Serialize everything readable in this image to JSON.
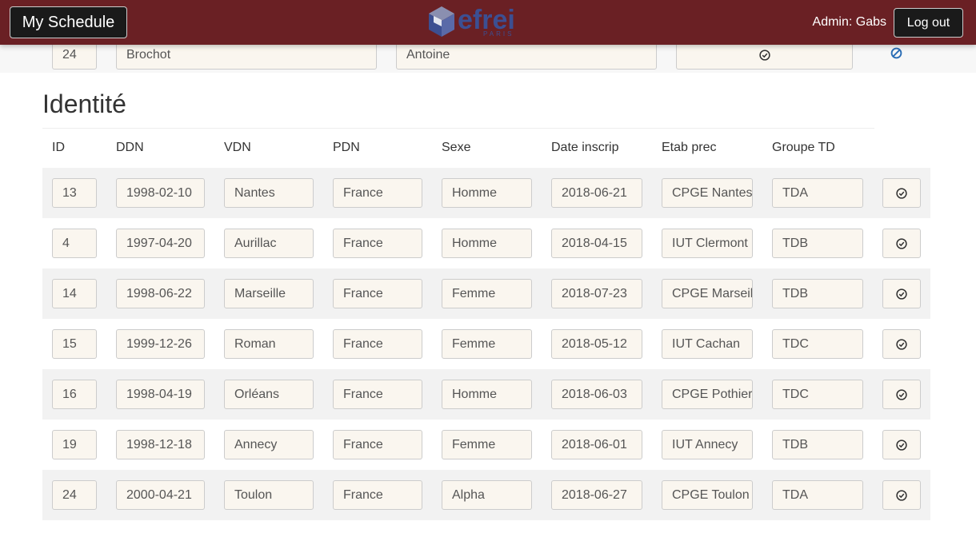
{
  "navbar": {
    "brand_label": "My Schedule",
    "logo_text": "efrei",
    "logo_sub": "PARIS",
    "admin_label": "Admin: Gabs",
    "logout_label": "Log out"
  },
  "top_row": {
    "id": "24",
    "last_name": "Brochot",
    "first_name": "Antoine"
  },
  "section": {
    "title": "Identité",
    "headers": [
      "ID",
      "DDN",
      "VDN",
      "PDN",
      "Sexe",
      "Date inscrip",
      "Etab prec",
      "Groupe TD"
    ]
  },
  "rows": [
    {
      "id": "13",
      "ddn": "1998-02-10",
      "vdn": "Nantes",
      "pdn": "France",
      "sexe": "Homme",
      "date": "2018-06-21",
      "etab": "CPGE Nantes",
      "groupe": "TDA"
    },
    {
      "id": "4",
      "ddn": "1997-04-20",
      "vdn": "Aurillac",
      "pdn": "France",
      "sexe": "Homme",
      "date": "2018-04-15",
      "etab": "IUT Clermont",
      "groupe": "TDB"
    },
    {
      "id": "14",
      "ddn": "1998-06-22",
      "vdn": "Marseille",
      "pdn": "France",
      "sexe": "Femme",
      "date": "2018-07-23",
      "etab": "CPGE Marseille",
      "groupe": "TDB"
    },
    {
      "id": "15",
      "ddn": "1999-12-26",
      "vdn": "Roman",
      "pdn": "France",
      "sexe": "Femme",
      "date": "2018-05-12",
      "etab": "IUT Cachan",
      "groupe": "TDC"
    },
    {
      "id": "16",
      "ddn": "1998-04-19",
      "vdn": "Orléans",
      "pdn": "France",
      "sexe": "Homme",
      "date": "2018-06-03",
      "etab": "CPGE Pothier",
      "groupe": "TDC"
    },
    {
      "id": "19",
      "ddn": "1998-12-18",
      "vdn": "Annecy",
      "pdn": "France",
      "sexe": "Femme",
      "date": "2018-06-01",
      "etab": "IUT Annecy",
      "groupe": "TDB"
    },
    {
      "id": "24",
      "ddn": "2000-04-21",
      "vdn": "Toulon",
      "pdn": "France",
      "sexe": "Alpha",
      "date": "2018-06-27",
      "etab": "CPGE Toulon",
      "groupe": "TDA"
    }
  ],
  "icons": {
    "confirm": "check-circle-icon",
    "ban": "ban-icon"
  },
  "colors": {
    "navbar": "#6a2024",
    "field_bg": "#faf6ef",
    "logo": "#3c4f92",
    "ban": "#2a6db5"
  }
}
